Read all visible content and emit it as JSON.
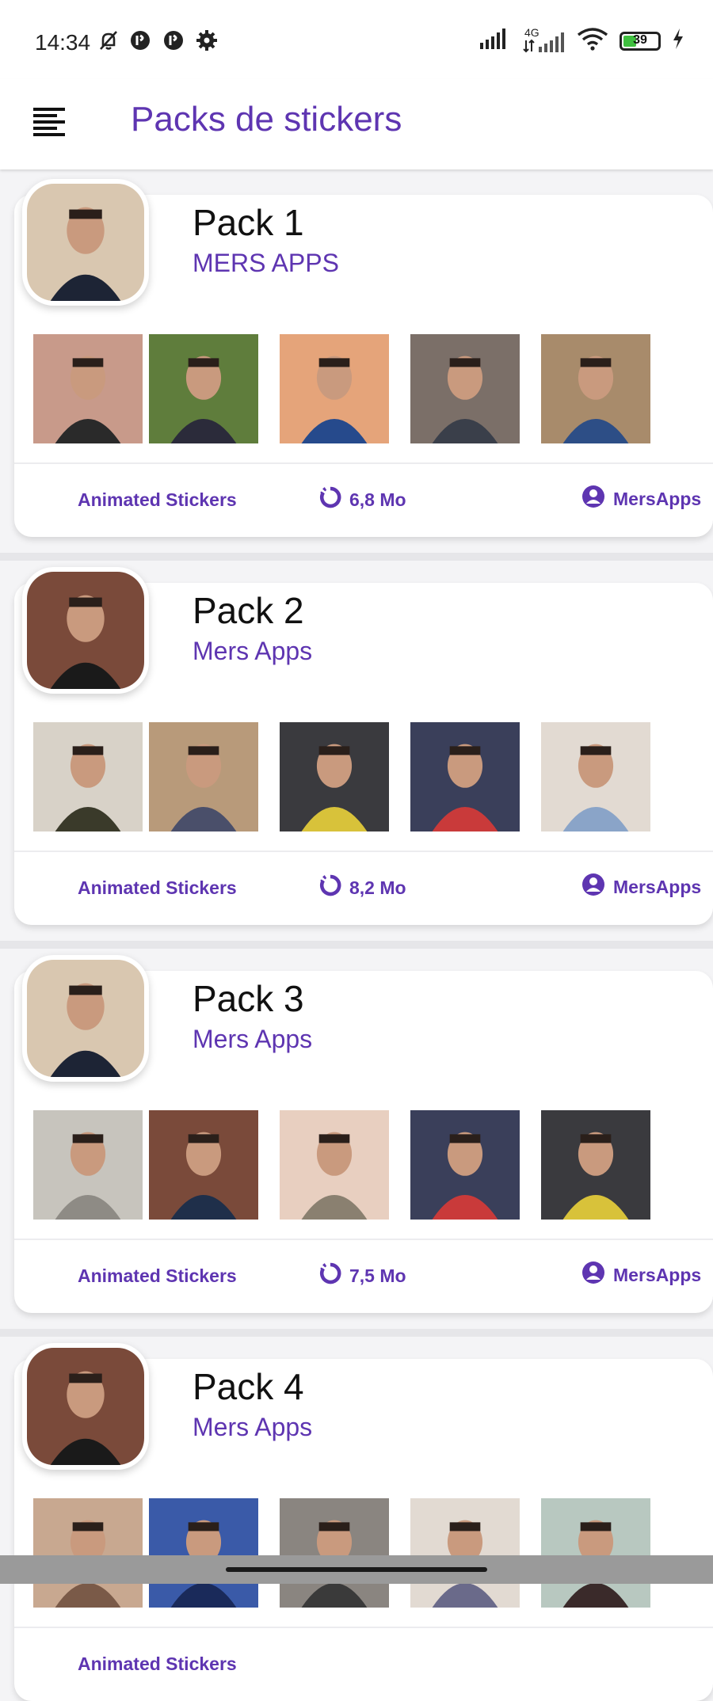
{
  "status_bar": {
    "time": "14:34",
    "left_icons": [
      "mute-icon",
      "notification-app-icon",
      "notification-app-icon",
      "settings-gear-icon"
    ],
    "network": "4G",
    "battery_level": "39",
    "battery_fraction": 0.39,
    "right_icons": [
      "signal-icon",
      "signal-4g-icon",
      "wifi-icon",
      "battery-icon",
      "charging-bolt-icon"
    ]
  },
  "app_bar": {
    "title": "Packs de stickers",
    "menu_icon": "hamburger-menu-icon"
  },
  "colors": {
    "accent": "#5e35b1",
    "background": "#f4f4f6",
    "card": "#ffffff",
    "text": "#111111"
  },
  "packs": [
    {
      "name": "Pack 1",
      "publisher": "MERS APPS",
      "type": "Animated Stickers",
      "size": "6,8 Mo",
      "author": "MersApps",
      "tray_colors": [
        "#d9c7b0",
        "#1d2435"
      ],
      "stickers": [
        [
          "#c89a8a",
          "#2a2a2a"
        ],
        [
          "#5f7d3c",
          "#2b2b3a"
        ],
        [
          "#e5a47a",
          "#264a8c"
        ],
        [
          "#7b6f68",
          "#3a3f4a"
        ],
        [
          "#a88b6b",
          "#2d4e86"
        ]
      ]
    },
    {
      "name": "Pack 2",
      "publisher": "Mers Apps",
      "type": "Animated Stickers",
      "size": "8,2 Mo",
      "author": "MersApps",
      "tray_colors": [
        "#7a4a3a",
        "#1a1a1a"
      ],
      "stickers": [
        [
          "#d8d2c8",
          "#3a3a2a"
        ],
        [
          "#b89a7a",
          "#4a4f6a"
        ],
        [
          "#3a3a3e",
          "#d8c23a"
        ],
        [
          "#3a3f5a",
          "#c93a3a"
        ],
        [
          "#e2dad2",
          "#8aa4c8"
        ]
      ]
    },
    {
      "name": "Pack 3",
      "publisher": "Mers Apps",
      "type": "Animated Stickers",
      "size": "7,5 Mo",
      "author": "MersApps",
      "tray_colors": [
        "#d9c7b0",
        "#1d2435"
      ],
      "stickers": [
        [
          "#c7c4bd",
          "#8e8b85"
        ],
        [
          "#7a4a3a",
          "#1f2f4a"
        ],
        [
          "#e8cfc0",
          "#8a8070"
        ],
        [
          "#3a3f5a",
          "#c93a3a"
        ],
        [
          "#3a3a3e",
          "#d8c23a"
        ]
      ]
    },
    {
      "name": "Pack 4",
      "publisher": "Mers Apps",
      "type": "Animated Stickers",
      "size": "",
      "author": "",
      "tray_colors": [
        "#7a4a3a",
        "#1a1a1a"
      ],
      "stickers": [
        [
          "#c8a890",
          "#7a5a48"
        ],
        [
          "#3a5aa8",
          "#1a2a5a"
        ],
        [
          "#8a8580",
          "#3a3a3a"
        ],
        [
          "#e2dad2",
          "#6a6a8a"
        ],
        [
          "#b8c8c0",
          "#3a2a2a"
        ]
      ]
    }
  ]
}
